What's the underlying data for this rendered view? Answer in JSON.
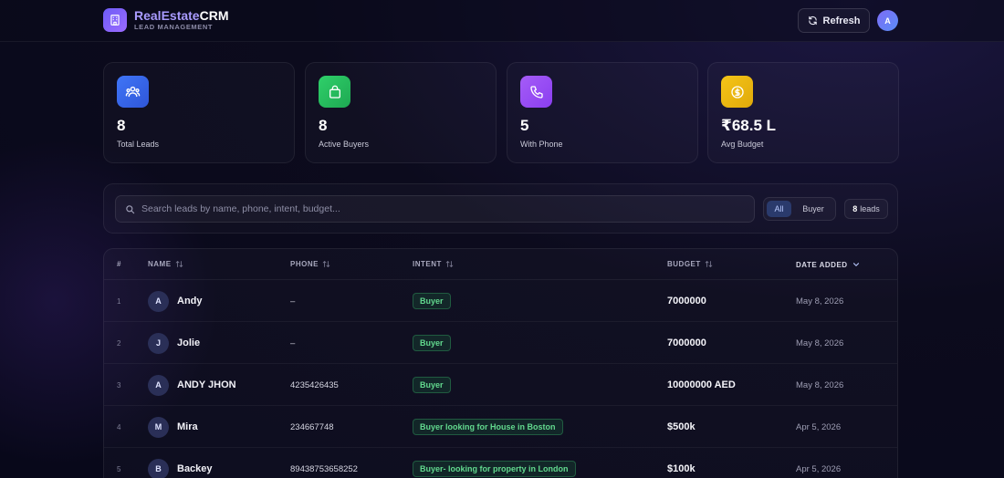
{
  "header": {
    "brand_part1": "RealEstate",
    "brand_part2": "CRM",
    "brand_subtitle": "LEAD MANAGEMENT",
    "refresh_label": "Refresh",
    "avatar_initial": "A"
  },
  "stats": [
    {
      "value": "8",
      "label": "Total Leads",
      "icon": "users-icon",
      "color": "#3b6cf5"
    },
    {
      "value": "8",
      "label": "Active Buyers",
      "icon": "shopping-bag-icon",
      "color": "#22c55e"
    },
    {
      "value": "5",
      "label": "With Phone",
      "icon": "phone-icon",
      "color": "#a855f7"
    },
    {
      "value": "₹68.5 L",
      "label": "Avg Budget",
      "icon": "coin-icon",
      "color": "#eab308"
    }
  ],
  "filters": {
    "search_placeholder": "Search leads by name, phone, intent, budget...",
    "search_value": "",
    "segments": [
      "All",
      "Buyer"
    ],
    "active_segment": "All",
    "count_value": "8",
    "count_label": "leads"
  },
  "table": {
    "columns": [
      "#",
      "NAME",
      "PHONE",
      "INTENT",
      "BUDGET",
      "DATE ADDED"
    ],
    "rows": [
      {
        "num": "1",
        "initial": "A",
        "name": "Andy",
        "phone": "–",
        "intent": "Buyer",
        "budget": "7000000",
        "date": "May 8, 2026"
      },
      {
        "num": "2",
        "initial": "J",
        "name": "Jolie",
        "phone": "–",
        "intent": "Buyer",
        "budget": "7000000",
        "date": "May 8, 2026"
      },
      {
        "num": "3",
        "initial": "A",
        "name": "ANDY JHON",
        "phone": "4235426435",
        "intent": "Buyer",
        "budget": "10000000 AED",
        "date": "May 8, 2026"
      },
      {
        "num": "4",
        "initial": "M",
        "name": "Mira",
        "phone": "234667748",
        "intent": "Buyer looking for House in Boston",
        "budget": "$500k",
        "date": "Apr 5, 2026"
      },
      {
        "num": "5",
        "initial": "B",
        "name": "Backey",
        "phone": "89438753658252",
        "intent": "Buyer- looking for property in London",
        "budget": "$100k",
        "date": "Apr 5, 2026"
      }
    ]
  }
}
